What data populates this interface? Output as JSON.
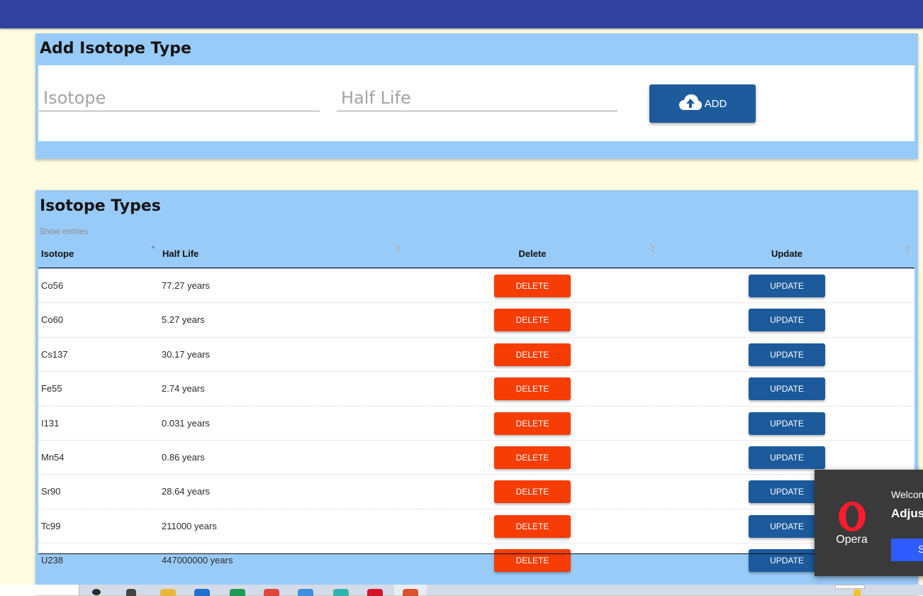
{
  "add_section": {
    "title": "Add Isotope Type",
    "isotope_placeholder": "Isotope",
    "isotope_value": "",
    "half_life_placeholder": "Half Life",
    "half_life_value": "",
    "add_label": "ADD",
    "add_icon": "cloud-upload-icon"
  },
  "list_section": {
    "title": "Isotope Types",
    "show_entries": "Show entries",
    "columns": [
      "Isotope",
      "Half Life",
      "Delete",
      "Update"
    ],
    "sorted_column": "Isotope",
    "delete_label": "DELETE",
    "update_label": "UPDATE",
    "rows": [
      {
        "isotope": "Co56",
        "half_life": "77.27 years"
      },
      {
        "isotope": "Co60",
        "half_life": "5.27 years"
      },
      {
        "isotope": "Cs137",
        "half_life": "30.17 years"
      },
      {
        "isotope": "Fe55",
        "half_life": "2.74 years"
      },
      {
        "isotope": "I131",
        "half_life": "0.031 years"
      },
      {
        "isotope": "Mn54",
        "half_life": "0.86 years"
      },
      {
        "isotope": "Sr90",
        "half_life": "28.64 years"
      },
      {
        "isotope": "Tc99",
        "half_life": "211000 years"
      },
      {
        "isotope": "U238",
        "half_life": "447000000 years"
      }
    ]
  },
  "opera_notification": {
    "app_name": "Opera",
    "welcome": "Welcome",
    "heading": "Adjust",
    "button_label": "S",
    "logo_icon": "opera-logo-icon"
  },
  "colors": {
    "topbar": "#3342a1",
    "card": "#99cbf8",
    "page_background": "#fffde1",
    "delete": "#f53d05",
    "update": "#1c5a9c",
    "add": "#1d5b9c"
  }
}
